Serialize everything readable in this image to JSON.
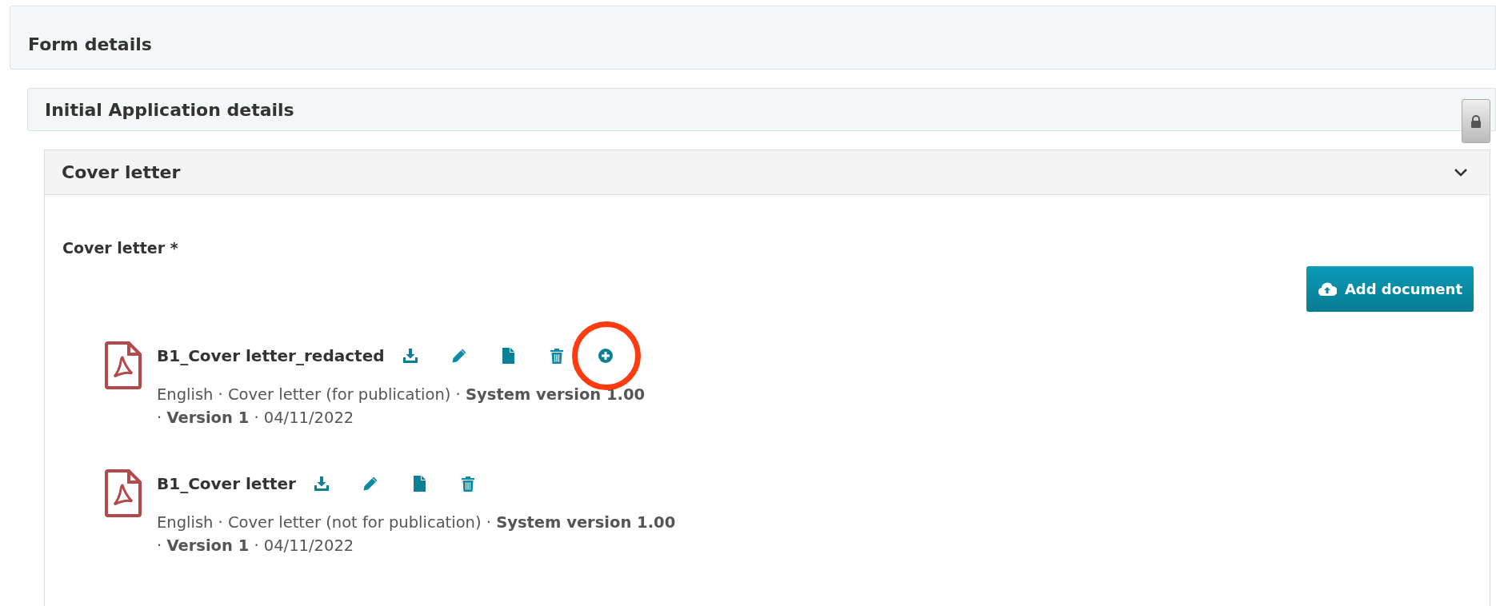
{
  "form_panel": {
    "title": "Form details"
  },
  "application_panel": {
    "title": "Initial Application details",
    "locked": true
  },
  "section": {
    "title": "Cover letter",
    "expanded": true,
    "field_label": "Cover letter *",
    "add_button": "Add document",
    "documents": [
      {
        "name": "B1_Cover letter_redacted",
        "meta_lines": [
          "English · Cover letter (for publication) · **System version 1.00**",
          "· **Version 1** · 04/11/2022"
        ],
        "actions": [
          {
            "kind": "download",
            "highlighted": false
          },
          {
            "kind": "edit",
            "highlighted": false
          },
          {
            "kind": "file",
            "highlighted": false
          },
          {
            "kind": "delete",
            "highlighted": false
          },
          {
            "kind": "add",
            "highlighted": true
          }
        ]
      },
      {
        "name": "B1_Cover letter",
        "meta_lines": [
          "English · Cover letter (not for publication) · **System version 1.00**",
          "· **Version 1** · 04/11/2022"
        ],
        "actions": [
          {
            "kind": "download",
            "highlighted": false
          },
          {
            "kind": "edit",
            "highlighted": false
          },
          {
            "kind": "file",
            "highlighted": false
          },
          {
            "kind": "delete",
            "highlighted": false
          }
        ]
      }
    ]
  }
}
